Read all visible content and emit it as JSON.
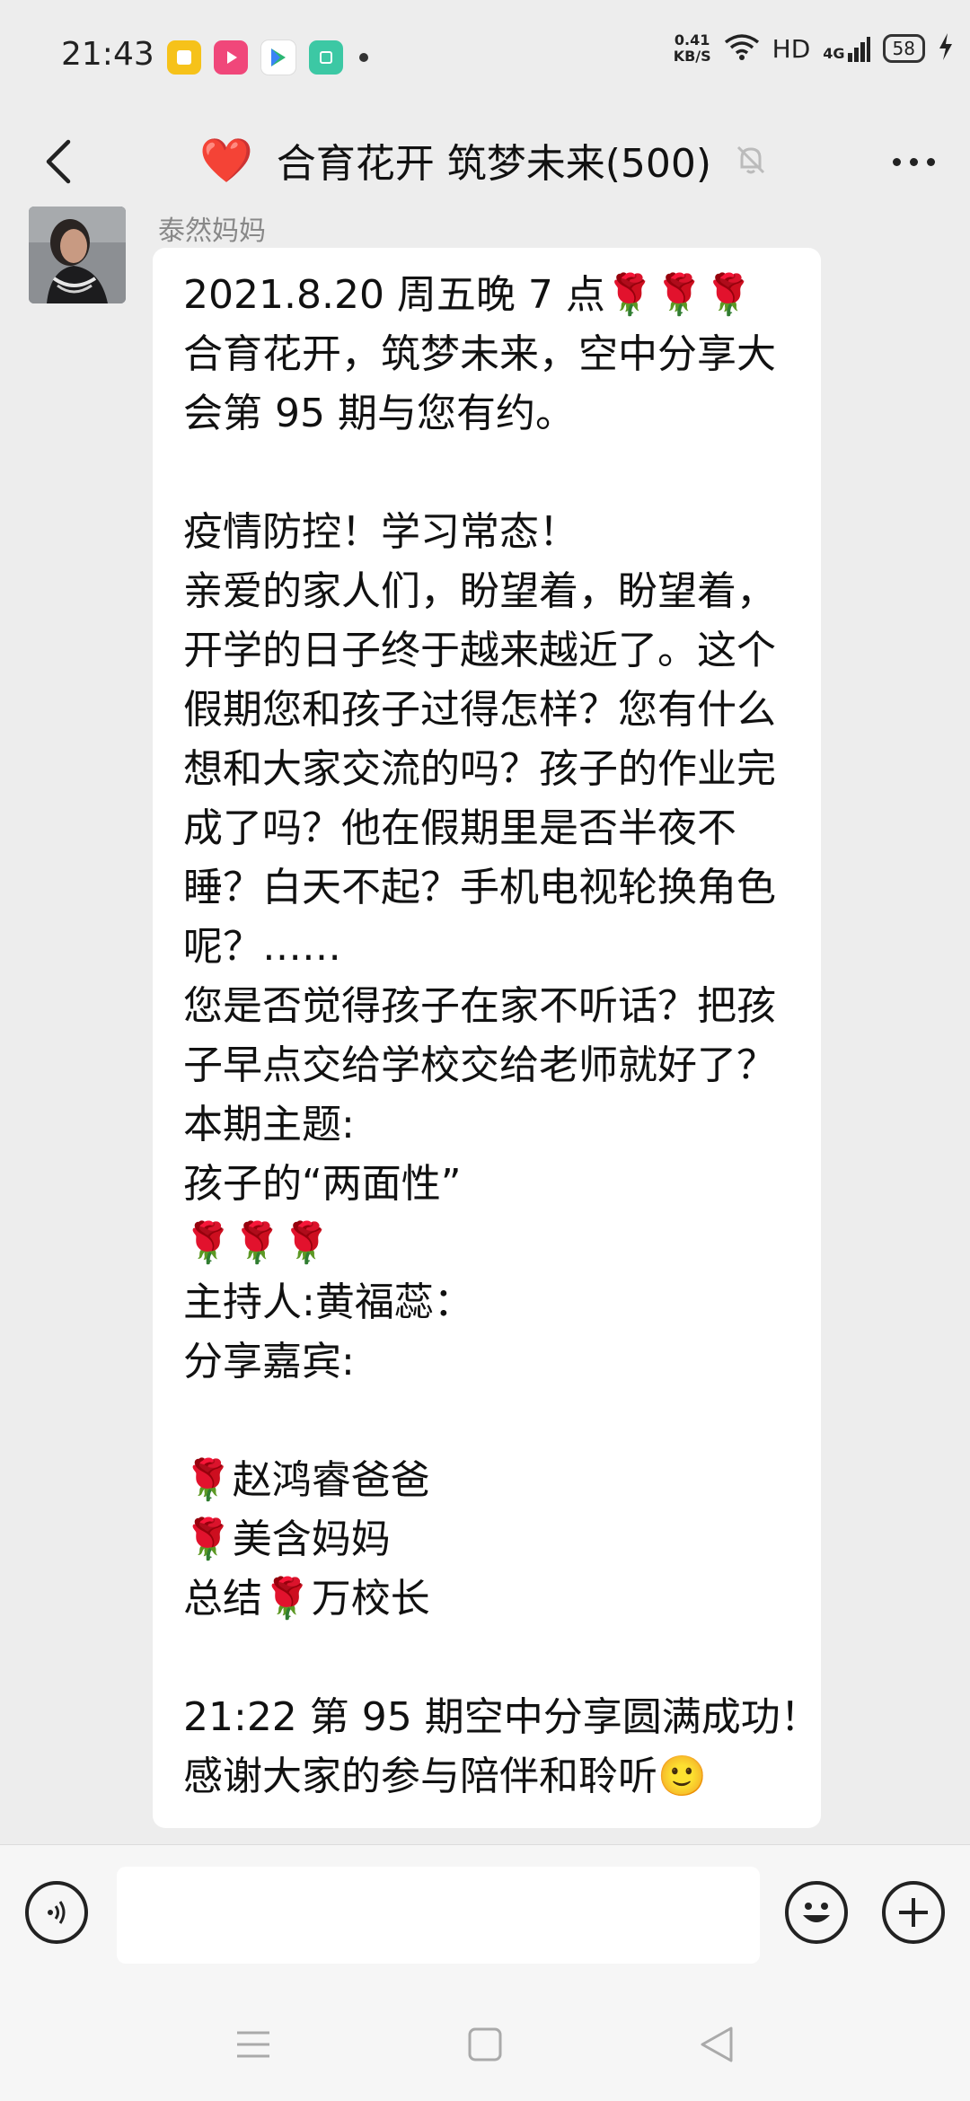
{
  "status_bar": {
    "time": "21:43",
    "net_speed_value": "0.41",
    "net_speed_unit": "KB/S",
    "hd_label": "HD",
    "network_label": "4G",
    "battery_level": "58",
    "icons": [
      "notes-app-icon",
      "video-app-icon",
      "play-store-icon",
      "app-icon",
      "more-notifications-dot",
      "wifi-icon",
      "signal-icon",
      "battery-icon",
      "charging-icon"
    ]
  },
  "header": {
    "title_emoji": "❤️",
    "title": "合育花开 筑梦未来(500)",
    "icons": [
      "back-arrow-icon",
      "bell-muted-icon",
      "more-dots-icon"
    ]
  },
  "message": {
    "sender": "泰然妈妈",
    "lines": [
      "2021.8.20  周五晚 7 点🌹🌹🌹",
      "合育花开，筑梦未来，空中分享大",
      "会第 95 期与您有约。",
      "",
      "疫情防控！学习常态！",
      "亲爱的家人们，盼望着，盼望着，",
      "开学的日子终于越来越近了。这个",
      "假期您和孩子过得怎样？您有什么",
      "想和大家交流的吗？孩子的作业完",
      "成了吗？他在假期里是否半夜不",
      "睡？白天不起？手机电视轮换角色",
      "呢？……",
      "您是否觉得孩子在家不听话？把孩",
      "子早点交给学校交给老师就好了？",
      "本期主题:",
      "孩子的“两面性”",
      "🌹🌹🌹",
      "主持人:黄福蕊：",
      "分享嘉宾:",
      "",
      "🌹赵鸿睿爸爸",
      "🌹美含妈妈",
      "总结🌹万校长",
      "",
      "21:22 第 95 期空中分享圆满成功！",
      "感谢大家的参与陪伴和聆听🙂"
    ]
  },
  "input_bar": {
    "text_value": "",
    "icons": [
      "voice-icon",
      "emoji-icon",
      "plus-icon"
    ]
  },
  "nav_bar": {
    "icons": [
      "menu-icon",
      "home-icon",
      "back-icon"
    ]
  }
}
